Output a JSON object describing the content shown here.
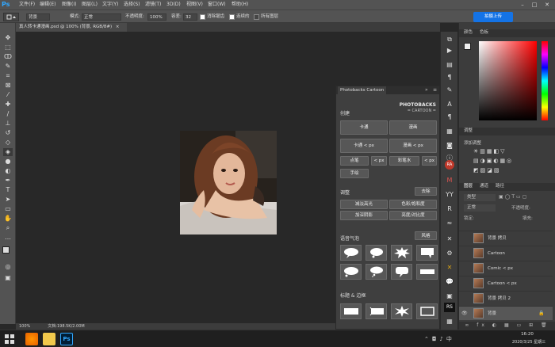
{
  "app": {
    "logo": "Ps"
  },
  "menu": [
    "文件(F)",
    "编辑(E)",
    "图像(I)",
    "图层(L)",
    "文字(Y)",
    "选择(S)",
    "滤镜(T)",
    "3D(D)",
    "视图(V)",
    "窗口(W)",
    "帮助(H)"
  ],
  "window_controls": [
    "–",
    "□",
    "✕"
  ],
  "options": {
    "mode_label": "模式:",
    "mode_value": "正常",
    "brush_value": "背景",
    "opacity_label": "不透明度:",
    "opacity_value": "100%",
    "tolerance_label": "容差:",
    "tolerance_value": "32",
    "antialias_label": "消除锯齿",
    "contiguous_label": "连续的",
    "all_layers_label": "所有图层",
    "share_label": "拍摄上传"
  },
  "document_tab": {
    "title": "真人转卡通漫画.psd @ 100% (背景, RGB/8#)",
    "close": "×"
  },
  "status": {
    "zoom": "100%",
    "doc_info": "文档:198.5K/2.00M"
  },
  "cartoon_panel": {
    "tab": "Photobacks Cartoon",
    "brand_line1": "PHOTOBACKS",
    "brand_line2": "= CARTOON =",
    "section_create": "创建",
    "btn_cartoon": "卡通",
    "btn_comic": "漫画",
    "btn_cartoon_px": "卡通 < px",
    "btn_comic_px": "漫画 < px",
    "small_btns": [
      "点笔",
      "< px",
      "彩笔水",
      "< px"
    ],
    "btn_single": "手绘",
    "section_adjust": "调整",
    "btn_apply": "去除",
    "adjust_btns": [
      "减淡高光",
      "色彩/饱和度",
      "加深阴影",
      "亮度/对比度"
    ],
    "section_speech": "语音气泡",
    "btn_style": "风格",
    "section_title": "标题 & 边框"
  },
  "color_panel": {
    "tab1": "颜色",
    "tab2": "色板"
  },
  "adjust_panel": {
    "tab": "调整",
    "label": "添加调整"
  },
  "layers_panel": {
    "tabs": [
      "图层",
      "通道",
      "路径"
    ],
    "kind_label": "类型",
    "blend_mode": "正常",
    "opacity_label": "不透明度:",
    "lock_label": "锁定:",
    "fill_label": "填充:",
    "layers": [
      "背景 拷贝",
      "Cartoon",
      "Comic < px",
      "Cartoon < px",
      "背景 拷贝 2",
      "背景"
    ]
  },
  "taskbar": {
    "time": "16:20",
    "date": "2020/3/25 星期三"
  },
  "colors": {
    "accent": "#1473e6",
    "ps_blue": "#31a8ff",
    "panel_bg": "#3c3c3c"
  }
}
